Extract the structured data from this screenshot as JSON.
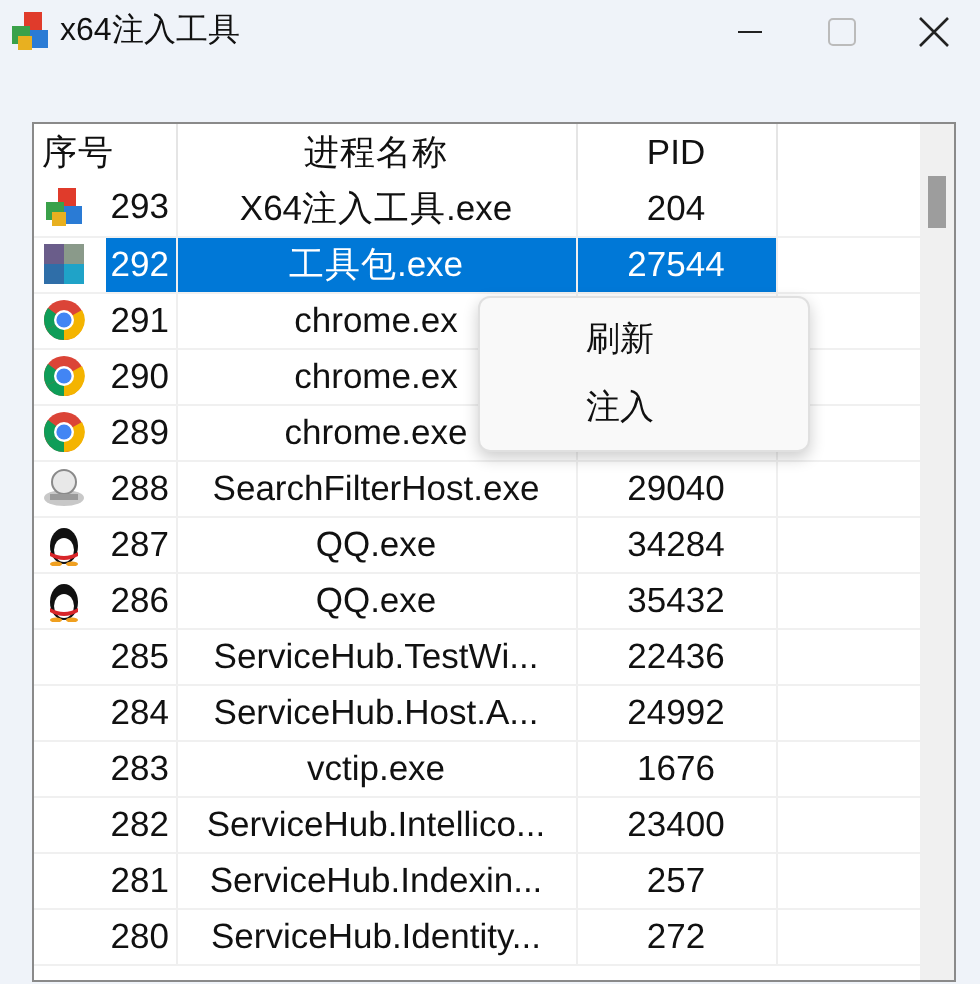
{
  "window": {
    "title": "x64注入工具"
  },
  "table": {
    "columns": [
      "序号",
      "进程名称",
      "PID"
    ],
    "rows": [
      {
        "kind": "blocks",
        "number": "293",
        "name": "X64注入工具.exe",
        "pid": "204",
        "selected": false
      },
      {
        "kind": "tiles",
        "number": "292",
        "name": "工具包.exe",
        "pid": "27544",
        "selected": true
      },
      {
        "kind": "chrome",
        "number": "291",
        "name": "chrome.ex",
        "selected": false
      },
      {
        "kind": "chrome",
        "number": "290",
        "name": "chrome.ex",
        "selected": false
      },
      {
        "kind": "chrome",
        "number": "289",
        "name": "chrome.exe",
        "selected": false
      },
      {
        "kind": "search",
        "number": "288",
        "name": "SearchFilterHost.exe",
        "pid": "29040",
        "selected": false
      },
      {
        "kind": "penguin",
        "number": "287",
        "name": "QQ.exe",
        "pid": "34284",
        "selected": false
      },
      {
        "kind": "penguin",
        "number": "286",
        "name": "QQ.exe",
        "pid": "35432",
        "selected": false
      },
      {
        "kind": "plain",
        "number": "285",
        "name": "ServiceHub.TestWi...",
        "pid": "22436",
        "selected": false
      },
      {
        "kind": "plain",
        "number": "284",
        "name": "ServiceHub.Host.A...",
        "pid": "24992",
        "selected": false
      },
      {
        "kind": "plain",
        "number": "283",
        "name": "vctip.exe",
        "pid": "1676",
        "selected": false
      },
      {
        "kind": "plain",
        "number": "282",
        "name": "ServiceHub.Intellico...",
        "pid": "23400",
        "selected": false
      },
      {
        "kind": "plain",
        "number": "281",
        "name": "ServiceHub.Indexin...",
        "pid": "257",
        "selected": false
      },
      {
        "kind": "plain",
        "number": "280",
        "name": "ServiceHub.Identity...",
        "pid": "272",
        "selected": false
      }
    ]
  },
  "context_menu": {
    "items": [
      "刷新",
      "注入"
    ]
  }
}
